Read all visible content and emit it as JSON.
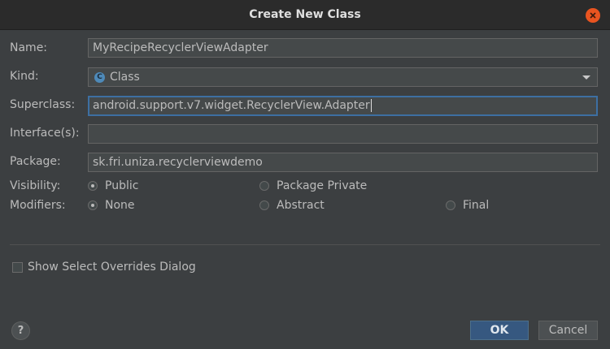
{
  "dialog": {
    "title": "Create New Class"
  },
  "form": {
    "name": {
      "label": "Name:",
      "value": "MyRecipeRecyclerViewAdapter"
    },
    "kind": {
      "label": "Kind:",
      "value": "Class",
      "icon": "class-icon",
      "icon_letter": "C"
    },
    "superclass": {
      "label": "Superclass:",
      "value": "android.support.v7.widget.RecyclerView.Adapter"
    },
    "interfaces": {
      "label": "Interface(s):",
      "value": ""
    },
    "package": {
      "label": "Package:",
      "value": "sk.fri.uniza.recyclerviewdemo"
    },
    "visibility": {
      "label": "Visibility:",
      "options": [
        "Public",
        "Package Private"
      ],
      "selected": "Public"
    },
    "modifiers": {
      "label": "Modifiers:",
      "options": [
        "None",
        "Abstract",
        "Final"
      ],
      "selected": "None"
    }
  },
  "overrides_checkbox": {
    "label": "Show Select Overrides Dialog",
    "checked": false
  },
  "buttons": {
    "help": "?",
    "ok": "OK",
    "cancel": "Cancel"
  },
  "colors": {
    "accent": "#365880",
    "close": "#e95420",
    "background": "#3c3f41"
  }
}
